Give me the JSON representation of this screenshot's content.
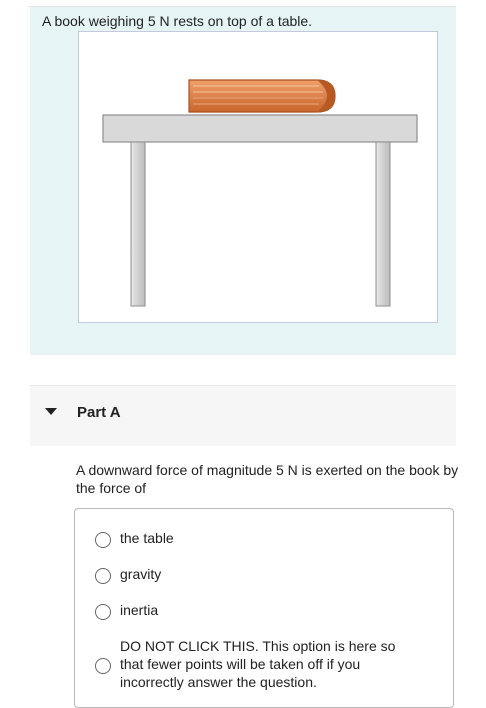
{
  "problem": {
    "statement": "A book weighing 5 N rests on top of a table."
  },
  "part": {
    "title": "Part A",
    "question": "A downward force of magnitude 5 N is exerted on the book by the force of"
  },
  "choices": [
    {
      "label": "the table"
    },
    {
      "label": "gravity"
    },
    {
      "label": "inertia"
    },
    {
      "label": "DO NOT CLICK THIS. This option is here so that fewer points will be taken off if you incorrectly answer the question."
    }
  ],
  "icons": {
    "collapse": "caret-down-icon",
    "radio": "radio-unchecked-icon",
    "figure": "book-on-table-illustration"
  },
  "colors": {
    "problem_background": "#e6f4f6",
    "book": "#d77a3e",
    "table": "#d9d9d9"
  }
}
